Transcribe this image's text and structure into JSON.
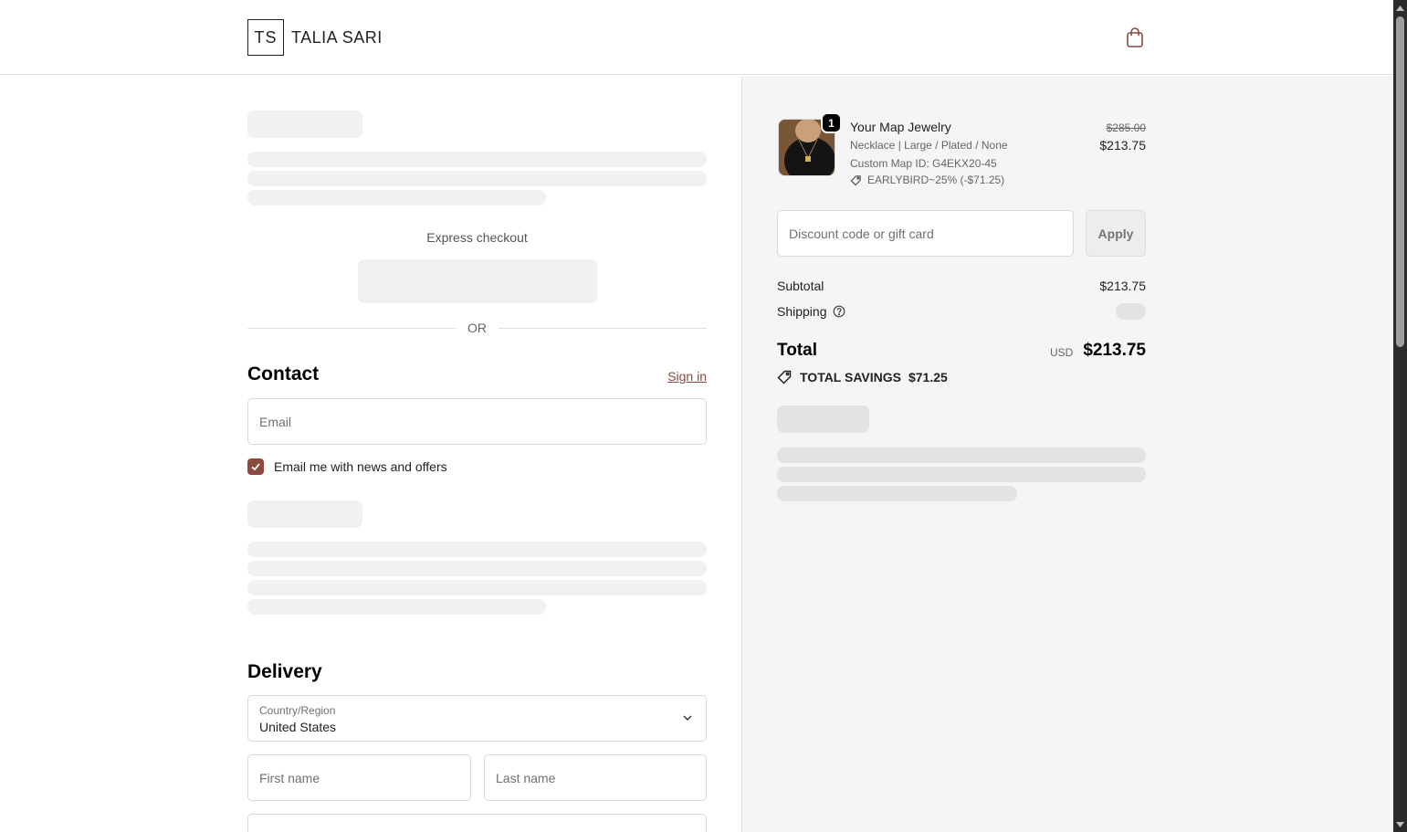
{
  "header": {
    "logo_mark": "TS",
    "brand_name": "TALIA SARI",
    "cart_icon": "shopping-bag-icon"
  },
  "express": {
    "label": "Express checkout",
    "divider": "OR"
  },
  "contact": {
    "title": "Contact",
    "sign_in": "Sign in",
    "email_placeholder": "Email",
    "newsletter_label": "Email me with news and offers",
    "newsletter_checked": true
  },
  "delivery": {
    "title": "Delivery",
    "country_label": "Country/Region",
    "country_value": "United States",
    "first_name_placeholder": "First name",
    "last_name_placeholder": "Last name"
  },
  "summary": {
    "item": {
      "quantity": "1",
      "name": "Your Map Jewelry",
      "variant": "Necklace | Large / Plated / None",
      "custom_id": "Custom Map ID: G4EKX20-45",
      "discount": "EARLYBIRD~25% (-$71.25)",
      "original_price": "$285.00",
      "price": "$213.75"
    },
    "discount_placeholder": "Discount code or gift card",
    "apply_label": "Apply",
    "subtotal_label": "Subtotal",
    "subtotal_value": "$213.75",
    "shipping_label": "Shipping",
    "total_label": "Total",
    "currency": "USD",
    "total_value": "$213.75",
    "savings_label": "TOTAL SAVINGS",
    "savings_value": "$71.25"
  },
  "colors": {
    "accent": "#8a4a3e",
    "summary_bg": "#f5f5f5",
    "skeleton": "#f1f1f1"
  }
}
